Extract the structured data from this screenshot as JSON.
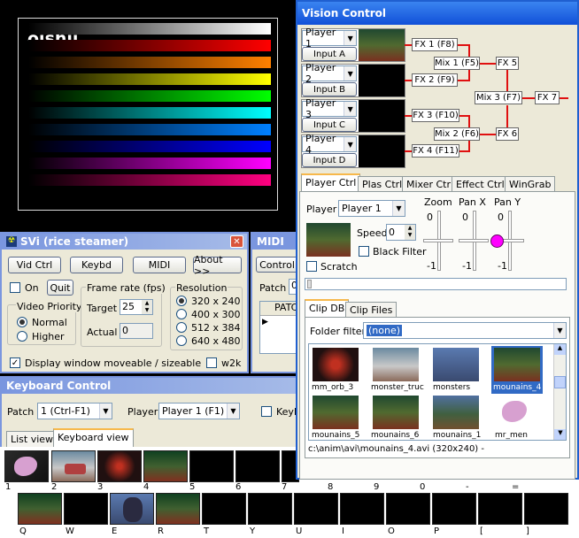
{
  "preview": {
    "logo": "oishii"
  },
  "svi": {
    "title": "SVi (rice steamer)",
    "vid_ctrl": "Vid Ctrl",
    "keybd": "Keybd",
    "midi": "MIDI",
    "about": "About >>",
    "on": "On",
    "quit": "Quit",
    "video_priority": "Video Priority",
    "normal": "Normal",
    "higher": "Higher",
    "frame_rate": "Frame rate (fps)",
    "target_label": "Target",
    "target_value": "25",
    "actual_label": "Actual",
    "actual_value": "0",
    "resolution": "Resolution",
    "res": [
      "320 x 240",
      "400 x 300",
      "512 x 384",
      "640 x 480"
    ],
    "display_moveable": "Display window moveable / sizeable",
    "w2k": "w2k"
  },
  "midi": {
    "title": "MIDI",
    "control_tab": "Control",
    "patch_label": "Patch",
    "patch_value": "0",
    "col": "PATC"
  },
  "keyboard": {
    "title": "Keyboard Control",
    "patch_label": "Patch",
    "patch_value": "1 (Ctrl-F1)",
    "player_label": "Player",
    "player_value": "Player 1 (F1)",
    "keyb": "Keyb",
    "tab_list": "List view",
    "tab_keyboard": "Keyboard view",
    "row1_labels": [
      "1",
      "2",
      "3",
      "4",
      "5",
      "6",
      "7",
      "8",
      "9",
      "0",
      "-",
      "="
    ],
    "row2_labels": [
      "Q",
      "W",
      "E",
      "R",
      "T",
      "Y",
      "U",
      "I",
      "O",
      "P",
      "[",
      "]"
    ]
  },
  "vision": {
    "title": "Vision Control",
    "players": [
      {
        "name": "Player 1",
        "input": "Input A"
      },
      {
        "name": "Player 2",
        "input": "Input B"
      },
      {
        "name": "Player 3",
        "input": "Input C"
      },
      {
        "name": "Player 4",
        "input": "Input D"
      }
    ],
    "fx1": "FX 1 (F8)",
    "fx2": "FX 2 (F9)",
    "fx3": "FX 3 (F10)",
    "fx4": "FX 4 (F11)",
    "mix1": "Mix 1 (F5)",
    "mix2": "Mix 2 (F6)",
    "mix3": "Mix 3 (F7)",
    "fx5": "FX 5",
    "fx6": "FX 6",
    "fx7": "FX 7",
    "tabs": [
      "Player Ctrl",
      "Plas Ctrl",
      "Mixer Ctrl",
      "Effect Ctrl",
      "WinGrab"
    ],
    "player_label": "Player",
    "player_value": "Player 1",
    "zoom": "Zoom",
    "pan_x": "Pan X",
    "pan_y": "Pan Y",
    "zero": "0",
    "minus1": "-1",
    "speed_label": "Speed",
    "speed_value": "0",
    "black_filter": "Black Filter",
    "scratch": "Scratch",
    "clip_tabs": [
      "Clip DB",
      "Clip Files"
    ],
    "folder_filter": "Folder filter",
    "folder_value": "(none)",
    "clips": [
      "mm_orb_3",
      "monster_truc",
      "monsters",
      "mounains_4",
      "mounains_5",
      "mounains_6",
      "mounains_1",
      "mr_men"
    ],
    "status": "c:\\anim\\avi\\mounains_4.avi (320x240)  -"
  }
}
